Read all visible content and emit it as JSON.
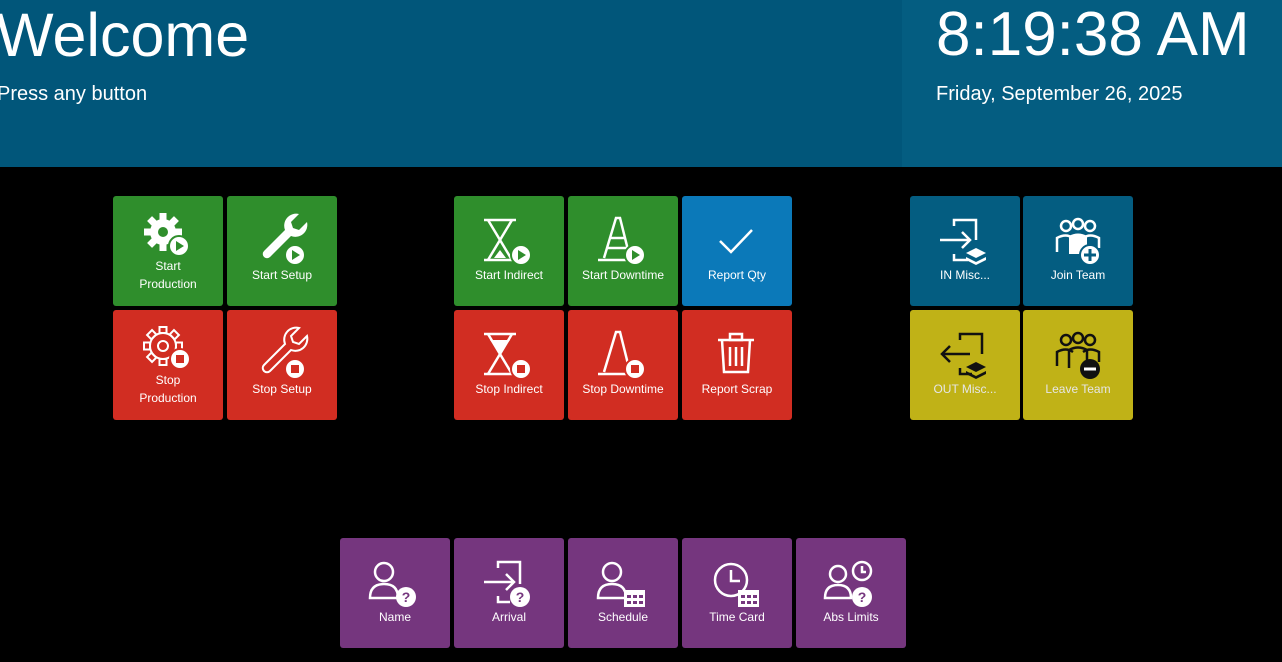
{
  "header": {
    "welcome": "Welcome",
    "subtitle": "Press any button",
    "time": "8:19:38 AM",
    "date": "Friday, September 26, 2025"
  },
  "production": {
    "start_production": [
      "Start",
      "Production"
    ],
    "start_setup": "Start Setup",
    "stop_production": [
      "Stop",
      "Production"
    ],
    "stop_setup": "Stop Setup"
  },
  "activities": {
    "start_indirect": "Start Indirect",
    "start_downtime": "Start Downtime",
    "report_qty": "Report Qty",
    "stop_indirect": "Stop Indirect",
    "stop_downtime": "Stop Downtime",
    "report_scrap": "Report Scrap"
  },
  "team": {
    "in_misc": "IN Misc...",
    "join_team": "Join Team",
    "out_misc": "OUT Misc...",
    "leave_team": "Leave Team"
  },
  "info": {
    "name": "Name",
    "arrival": "Arrival",
    "schedule": "Schedule",
    "time_card": "Time Card",
    "abs_limits": "Abs Limits"
  },
  "colors": {
    "header": "#01567a",
    "header_clock": "#045d81",
    "green": "#2f8e2c",
    "red": "#d12d22",
    "blue": "#0b79b9",
    "navy": "#045d81",
    "yellow": "#c0b217",
    "purple": "#75367e"
  },
  "icons": {
    "start_production": "gear-play-icon",
    "start_setup": "wrench-play-icon",
    "stop_production": "gear-stop-icon",
    "stop_setup": "wrench-stop-icon",
    "start_indirect": "hourglass-play-icon",
    "start_downtime": "cone-play-icon",
    "report_qty": "checkmark-icon",
    "stop_indirect": "hourglass-stop-icon",
    "stop_downtime": "cone-stop-icon",
    "report_scrap": "trash-icon",
    "in_misc": "sign-in-layers-icon",
    "join_team": "team-plus-icon",
    "out_misc": "sign-out-layers-icon",
    "leave_team": "team-minus-icon",
    "name": "person-question-icon",
    "arrival": "sign-in-question-icon",
    "schedule": "person-calendar-icon",
    "time_card": "clock-calendar-icon",
    "abs_limits": "person-clock-question-icon"
  }
}
